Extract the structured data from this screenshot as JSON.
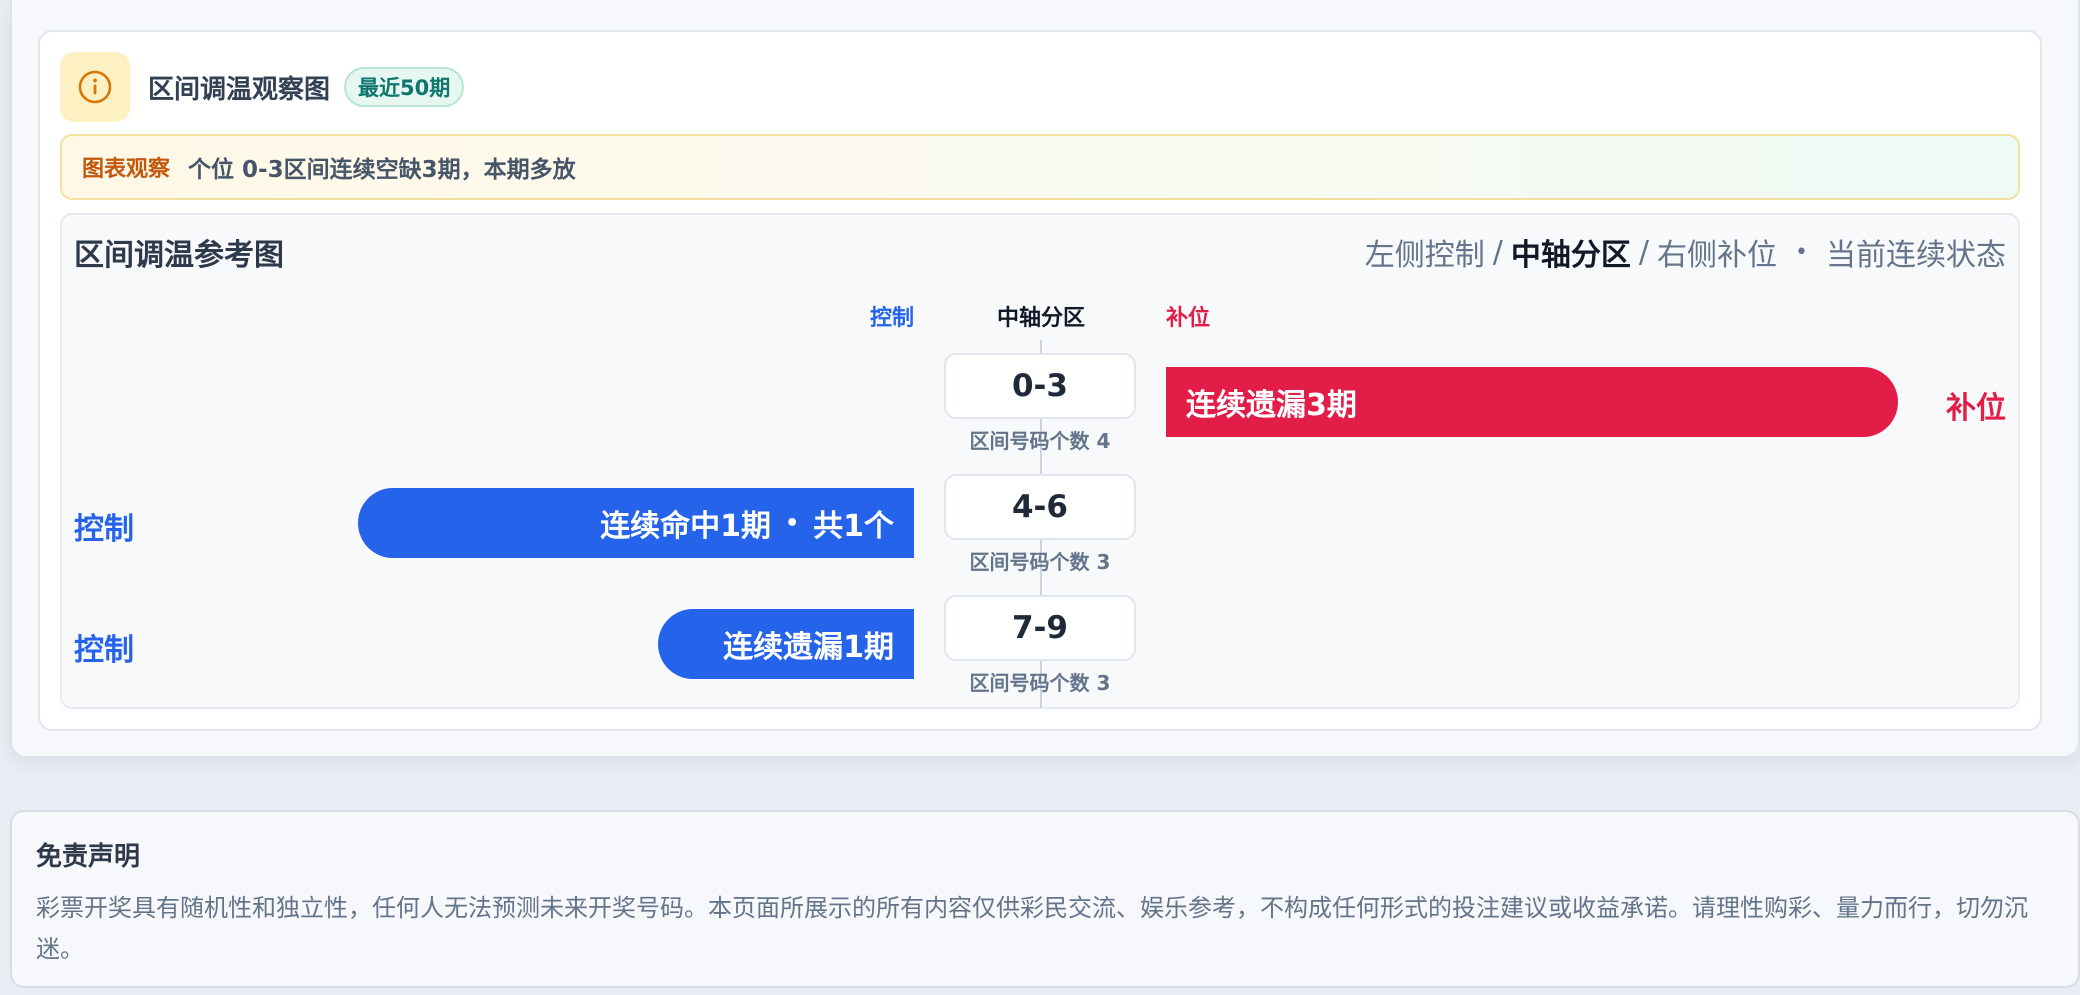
{
  "panel": {
    "title": "区间调温观察图",
    "period_badge": "最近50期",
    "info_icon": "info-icon"
  },
  "observation": {
    "label": "图表观察",
    "text": "个位 0-3区间连续空缺3期，本期多放"
  },
  "chart": {
    "title": "区间调温参考图",
    "legend": {
      "left": "左侧控制",
      "sep": "/",
      "center": "中轴分区",
      "right": "右侧补位",
      "bullet": "•",
      "state": "当前连续状态"
    },
    "headers": {
      "control": "控制",
      "axis": "中轴分区",
      "fill": "补位"
    }
  },
  "chart_data": {
    "type": "bar",
    "categories": [
      "0-3",
      "4-6",
      "7-9"
    ],
    "rows": [
      {
        "zone": "0-3",
        "count_label": "区间号码个数 4",
        "side": "补位",
        "bar_text": "连续遗漏3期",
        "bar_extra": "",
        "streak": 3,
        "color": "#e11d48"
      },
      {
        "zone": "4-6",
        "count_label": "区间号码个数 3",
        "side": "控制",
        "bar_text": "连续命中1期",
        "bar_extra": "共1个",
        "streak": 1,
        "color": "#2563eb"
      },
      {
        "zone": "7-9",
        "count_label": "区间号码个数 3",
        "side": "控制",
        "bar_text": "连续遗漏1期",
        "bar_extra": "",
        "streak": 1,
        "color": "#2563eb"
      }
    ]
  },
  "disclaimer": {
    "title": "免责声明",
    "text": "彩票开奖具有随机性和独立性，任何人无法预测未来开奖号码。本页面所展示的所有内容仅供彩民交流、娱乐参考，不构成任何形式的投注建议或收益承诺。请理性购彩、量力而行，切勿沉迷。"
  }
}
